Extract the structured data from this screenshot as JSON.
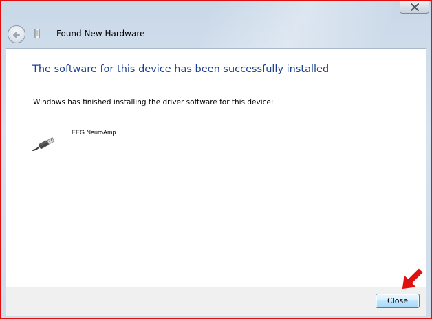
{
  "window": {
    "title": "Found New Hardware"
  },
  "content": {
    "heading": "The software for this device has been successfully installed",
    "message": "Windows has finished installing the driver software for this device:",
    "device": {
      "name": "EEG NeuroAmp",
      "icon": "usb-plug-icon"
    }
  },
  "footer": {
    "close_label": "Close"
  },
  "colors": {
    "heading": "#1b3f8f",
    "highlight_border": "#e01010",
    "annotation_arrow": "#e01010"
  }
}
